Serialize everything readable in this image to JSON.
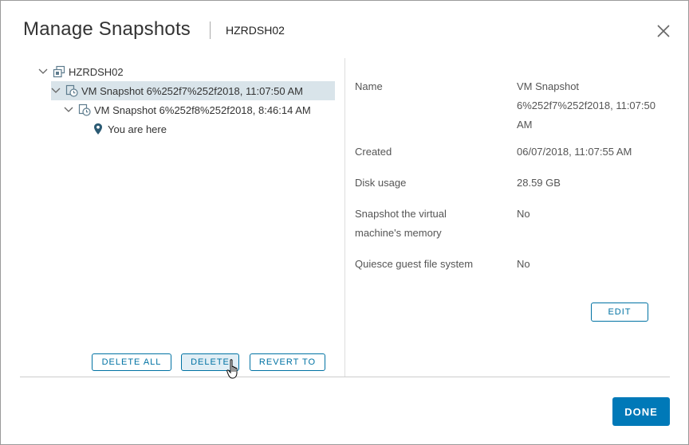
{
  "dialog": {
    "title": "Manage Snapshots",
    "vm_name": "HZRDSH02"
  },
  "tree": {
    "root_label": "HZRDSH02",
    "snapshot1_label": "VM Snapshot 6%252f7%252f2018, 11:07:50 AM",
    "snapshot2_label": "VM Snapshot 6%252f8%252f2018, 8:46:14 AM",
    "you_are_here_label": "You are here"
  },
  "buttons": {
    "delete_all": "DELETE ALL",
    "delete": "DELETE",
    "revert_to": "REVERT TO",
    "edit": "EDIT",
    "done": "DONE"
  },
  "properties": {
    "name_label": "Name",
    "name_value": "VM Snapshot 6%252f7%252f2018, 11:07:50 AM",
    "created_label": "Created",
    "created_value": "06/07/2018, 11:07:55 AM",
    "disk_label": "Disk usage",
    "disk_value": "28.59 GB",
    "memory_label": "Snapshot the virtual machine's memory",
    "memory_value": "No",
    "quiesce_label": "Quiesce guest file system",
    "quiesce_value": "No"
  },
  "colors": {
    "accent": "#0072a3",
    "primary_button": "#0079b8",
    "selection": "#d9e4ea"
  }
}
